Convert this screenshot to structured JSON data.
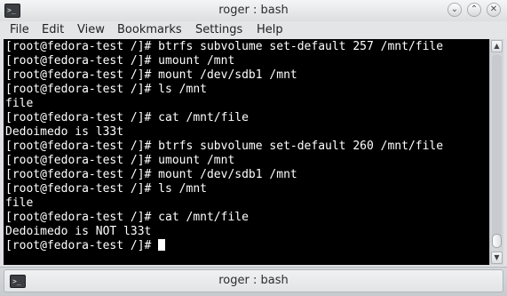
{
  "window": {
    "title": "roger : bash",
    "app_icon": "terminal-icon",
    "controls": [
      "minimize",
      "maximize",
      "close"
    ]
  },
  "menu": [
    "File",
    "Edit",
    "View",
    "Bookmarks",
    "Settings",
    "Help"
  ],
  "terminal": {
    "lines": [
      "[root@fedora-test /]# btrfs subvolume set-default 257 /mnt/file",
      "[root@fedora-test /]# umount /mnt",
      "[root@fedora-test /]# mount /dev/sdb1 /mnt",
      "[root@fedora-test /]# ls /mnt",
      "file",
      "[root@fedora-test /]# cat /mnt/file",
      "Dedoimedo is l33t",
      "[root@fedora-test /]# btrfs subvolume set-default 260 /mnt/file",
      "[root@fedora-test /]# umount /mnt",
      "[root@fedora-test /]# mount /dev/sdb1 /mnt",
      "[root@fedora-test /]# ls /mnt",
      "file",
      "[root@fedora-test /]# cat /mnt/file",
      "Dedoimedo is NOT l33t"
    ],
    "prompt": "[root@fedora-test /]# ",
    "colors": {
      "background": "#000000",
      "foreground": "#ffffff"
    }
  },
  "scrollbar": {
    "position": 1.0
  },
  "tabs": [
    {
      "label": "roger : bash",
      "icon": "terminal-icon"
    }
  ]
}
